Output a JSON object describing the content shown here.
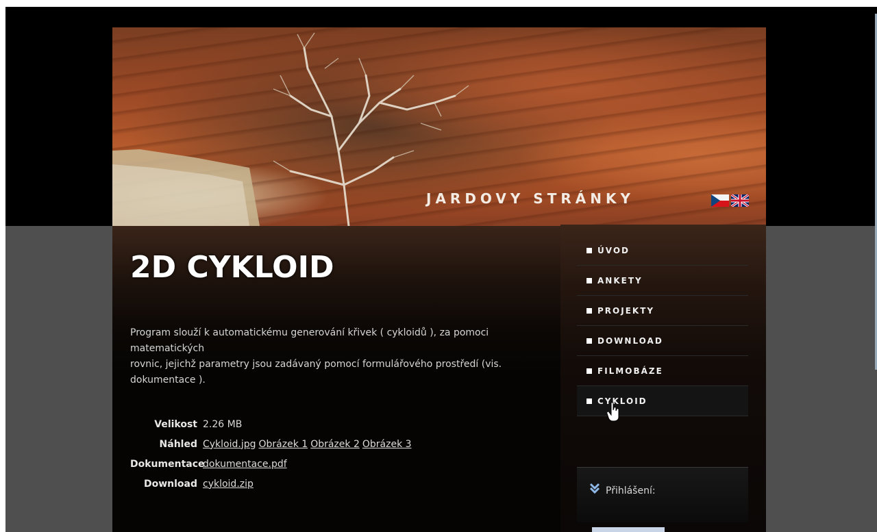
{
  "site": {
    "title": "JARDOVY STRÁNKY"
  },
  "languages": [
    {
      "code": "cs",
      "icon": "czech-flag-icon"
    },
    {
      "code": "en",
      "icon": "uk-flag-icon"
    }
  ],
  "page": {
    "title": "2D CYKLOID",
    "description": "Program slouží k automatickému generování křivek ( cykloidů ), za pomoci\nmatematických\nrovnic, jejichž parametry jsou zadávaný pomocí formulářového prostředí (vis.\ndokumentace )."
  },
  "info": {
    "size_label": "Velikost",
    "size_value": "2.26 MB",
    "preview_label": "Náhled",
    "preview_links": [
      "Cykloid.jpg",
      "Obrázek 1",
      "Obrázek 2",
      "Obrázek 3"
    ],
    "doc_label": "Dokumentace",
    "doc_link": "dokumentace.pdf",
    "download_label": "Download",
    "download_link": "cykloid.zip"
  },
  "menu": {
    "items": [
      "ÚVOD",
      "ANKETY",
      "PROJEKTY",
      "DOWNLOAD",
      "FILMOBÁZE",
      "CYKLOID"
    ],
    "active": "CYKLOID"
  },
  "login": {
    "label": "Přihlášení:",
    "icon": "chevron-down-icon"
  },
  "colors": {
    "background_band": "#4f4f4f",
    "page_bg": "#050403",
    "accent_text": "#f0f0f0"
  }
}
